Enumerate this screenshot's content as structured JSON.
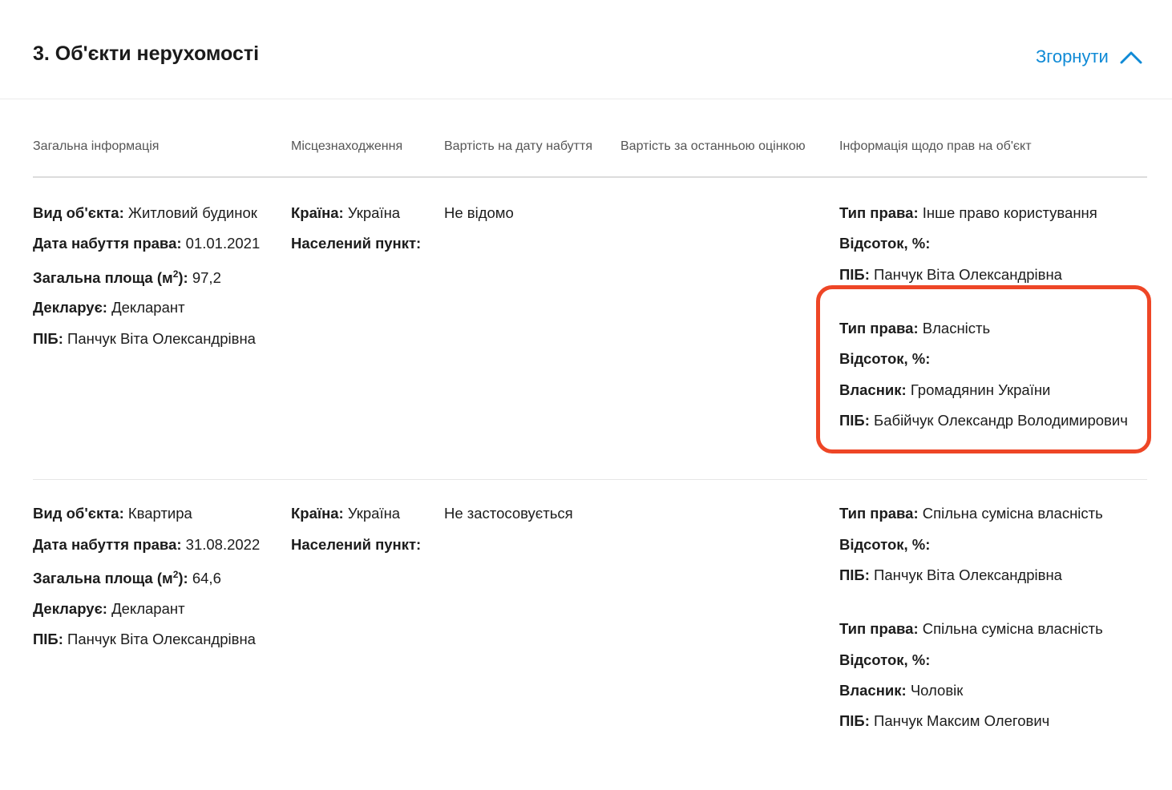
{
  "section": {
    "title": "3. Об'єкти нерухомості",
    "toggle_label": "Згорнути",
    "accent_color": "#0f8ad6",
    "highlight_color": "#ee4626"
  },
  "columns": [
    "Загальна інформація",
    "Місцезнаходження",
    "Вартість на дату набуття",
    "Вартість за останньою оцінкою",
    "Інформація щодо прав на об'єкт"
  ],
  "labels": {
    "object_type": "Вид об'єкта:",
    "acquired": "Дата набуття права:",
    "area": "Загальна площа (м",
    "area_sup": "2",
    "area_close": "):",
    "declares": "Декларує:",
    "name": "ПІБ:",
    "country": "Країна:",
    "locality": "Населений пункт:",
    "right_type": "Тип права:",
    "percent": "Відсоток, %:",
    "owner": "Власник:"
  },
  "rows": [
    {
      "object_type": "Житловий будинок",
      "acquired": "01.01.2021",
      "area": "97,2",
      "declares": "Декларант",
      "name": "Панчук Віта Олександрівна",
      "country": "Україна",
      "locality": "",
      "cost_acquisition": "Не відомо",
      "cost_last": "",
      "rights": [
        {
          "type": "Інше право користування",
          "percent": "",
          "name": "Панчук Віта Олександрівна"
        },
        {
          "type": "Власність",
          "percent": "",
          "owner": "Громадянин України",
          "name": "Бабійчук Олександр Володимирович",
          "highlighted": true
        }
      ]
    },
    {
      "object_type": "Квартира",
      "acquired": "31.08.2022",
      "area": "64,6",
      "declares": "Декларант",
      "name": "Панчук Віта Олександрівна",
      "country": "Україна",
      "locality": "",
      "cost_acquisition": "Не застосовується",
      "cost_last": "",
      "rights": [
        {
          "type": "Спільна сумісна власність",
          "percent": "",
          "name": "Панчук Віта Олександрівна"
        },
        {
          "type": "Спільна сумісна власність",
          "percent": "",
          "owner": "Чоловік",
          "name": "Панчук Максим Олегович"
        }
      ]
    }
  ]
}
